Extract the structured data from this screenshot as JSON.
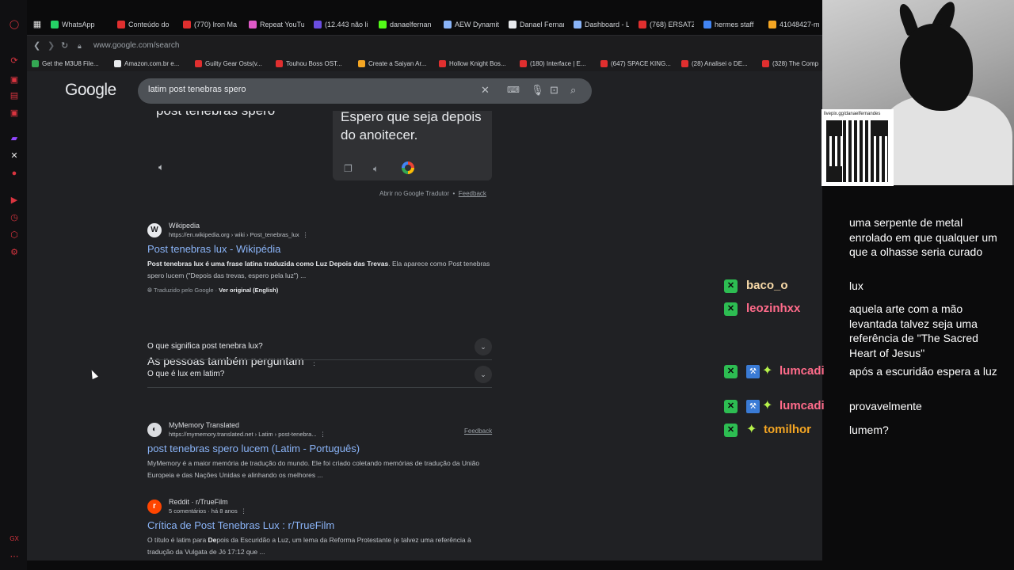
{
  "browser": {
    "url": "www.google.com/search",
    "tabs": [
      {
        "label": "WhatsApp",
        "color": "#25d366"
      },
      {
        "label": "Conteúdo do",
        "color": "#e02f2f"
      },
      {
        "label": "(770) Iron Ma",
        "color": "#e02f2f"
      },
      {
        "label": "Repeat YouTu",
        "color": "#e05ac8"
      },
      {
        "label": "(12.443 não li",
        "color": "#6a4de0"
      },
      {
        "label": "danaelfernan",
        "color": "#53fc18"
      },
      {
        "label": "AEW Dynamit",
        "color": "#8ab4f8"
      },
      {
        "label": "Danael Fernan",
        "color": "#e8eaed"
      },
      {
        "label": "Dashboard - L",
        "color": "#8ab4f8"
      },
      {
        "label": "(768) ERSATZ",
        "color": "#e02f2f"
      },
      {
        "label": "hermes staff",
        "color": "#4285f4"
      },
      {
        "label": "41048427-m",
        "color": "#f5a623"
      }
    ],
    "bookmarks": [
      {
        "label": "Get the M3U8 File...",
        "color": "#34a853"
      },
      {
        "label": "Amazon.com.br e...",
        "color": "#e8eaed"
      },
      {
        "label": "Guilty Gear Osts(v...",
        "color": "#e02f2f"
      },
      {
        "label": "Touhou Boss OST...",
        "color": "#e02f2f"
      },
      {
        "label": "Create a Saiyan Ar...",
        "color": "#f5a623"
      },
      {
        "label": "Hollow Knight Bos...",
        "color": "#e02f2f"
      },
      {
        "label": "(180) Interface | E...",
        "color": "#e02f2f"
      },
      {
        "label": "(647) SPACE KING...",
        "color": "#e02f2f"
      },
      {
        "label": "(28) Analisei o DE...",
        "color": "#e02f2f"
      },
      {
        "label": "(328) The Comp",
        "color": "#e02f2f"
      }
    ]
  },
  "google": {
    "logo": "Google",
    "query": "latim post tenebras spero",
    "translator": {
      "source_text": "post tenebras spero",
      "target_text": "Espero que seja depois do anoitecer.",
      "open_link": "Abrir no Google Tradutor",
      "separator": "•",
      "feedback": "Feedback"
    },
    "results": [
      {
        "fav": "W",
        "site": "Wikipedia",
        "url": "https://en.wikipedia.org › wiki › Post_tenebras_lux",
        "title": "Post tenebras lux - Wikipédia",
        "snippet_bold": "Post tenebras lux é uma frase latina traduzida como Luz Depois das Trevas",
        "snippet_rest": ". Ela aparece como Post tenebras spero lucem (\"Depois das trevas, espero pela luz\") ...",
        "translated_by": "Traduzido pelo Google  ·",
        "original": "Ver original (English)"
      },
      {
        "fav": "◐",
        "site": "MyMemory Translated",
        "url": "https://mymemory.translated.net › Latim › post-tenebra...",
        "title": "post tenebras spero lucem (Latim - Português)",
        "snippet": "MyMemory é a maior memória de tradução do mundo. Ele foi criado coletando memórias de tradução da União Europeia e das Nações Unidas e alinhando os melhores ..."
      },
      {
        "fav": "r",
        "site": "Reddit · r/TrueFilm",
        "meta": "5 comentários · há 8 anos",
        "title": "Crítica de Post Tenebras Lux : r/TrueFilm",
        "snippet_a": "O título é latim para ",
        "snippet_b": "De",
        "snippet_c": "pois da Escuridão a Luz, um lema da Reforma Protestante (e talvez uma referência à tradução da Vulgata de Jó 17:12 que ..."
      }
    ],
    "paa": {
      "title": "As pessoas também perguntam",
      "questions": [
        "O que significa post tenebra lux?",
        "O que é lux em latim?"
      ],
      "feedback": "Feedback"
    }
  },
  "stream": {
    "qr_label": "livepix.gg/danaelfernandes",
    "chat_prev": "uma serpente de metal enrolado em que qualquer um que a olhasse seria curado",
    "messages": [
      {
        "name": "baco_o",
        "color": "#f7d9a8",
        "text": "lux"
      },
      {
        "name": "leozinhxx",
        "color": "#ff6b8a",
        "text": "aquela arte com a mão levantada talvez seja uma referência de \"The Sacred Heart of Jesus\""
      },
      {
        "name": "lumcadi",
        "color": "#ff6b8a",
        "text": "após a escuridão espera a luz"
      },
      {
        "name": "lumcadi",
        "color": "#ff6b8a",
        "text": "provavelmente"
      },
      {
        "name": "tomilhor",
        "color": "#f5a623",
        "text": "lumem?"
      }
    ]
  }
}
